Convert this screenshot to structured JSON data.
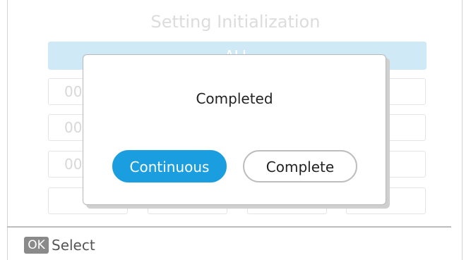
{
  "screen": {
    "title": "Setting Initialization",
    "all_label": "ALL",
    "rows": [
      {
        "label": "00"
      },
      {
        "label": "00"
      },
      {
        "label": "00"
      }
    ]
  },
  "dialog": {
    "message": "Completed",
    "continue_label": "Continuous",
    "complete_label": "Complete"
  },
  "footer": {
    "ok_key": "OK",
    "action": "Select"
  },
  "colors": {
    "accent": "#1a9ee0",
    "selected_row": "#cfe9f6",
    "dialog_shadow": "#cfcfcf"
  }
}
